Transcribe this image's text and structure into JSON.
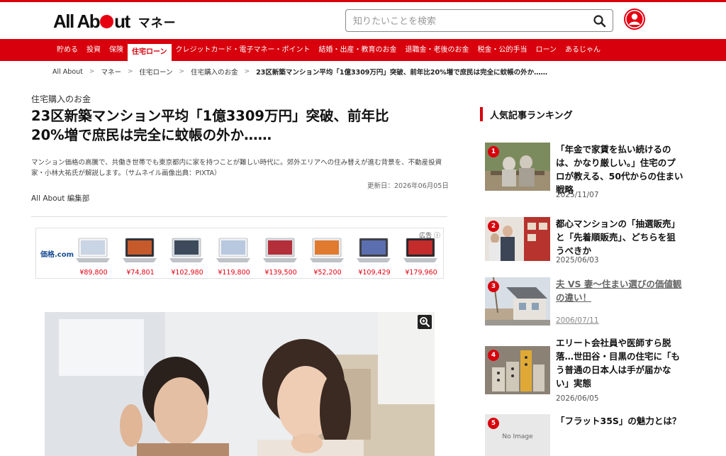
{
  "header": {
    "logo_text_1": "All Ab",
    "logo_text_2": "ut",
    "category": "マネー",
    "search_placeholder": "知りたいことを検索"
  },
  "nav": {
    "items": [
      {
        "label": "貯める"
      },
      {
        "label": "投資"
      },
      {
        "label": "保険"
      },
      {
        "label": "住宅ローン",
        "active": true
      },
      {
        "label": "クレジットカード・電子マネー・ポイント"
      },
      {
        "label": "結婚・出産・教育のお金"
      },
      {
        "label": "退職金・老後のお金"
      },
      {
        "label": "税金・公的手当"
      },
      {
        "label": "ローン"
      },
      {
        "label": "あるじゃん"
      }
    ]
  },
  "breadcrumb": {
    "items": [
      "All About",
      "マネー",
      "住宅ローン",
      "住宅購入のお金"
    ],
    "current": "23区新築マンション平均「1億3309万円」突破、前年比20%増で庶民は完全に蚊帳の外か……"
  },
  "article": {
    "category": "住宅購入のお金",
    "title_line1": "23区新築マンション平均「1億3309万円」突破、前年比",
    "title_line2": "20%増で庶民は完全に蚊帳の外か……",
    "description": "マンション価格の高騰で、共働き世帯でも東京都内に家を持つことが難しい時代に。郊外エリアへの住み替えが進む背景を、不動産投資家・小林大祐氏が解説します。（サムネイル画像出典：PIXTA）",
    "updated": "更新日：2026年06月05日",
    "author": "All About 編集部"
  },
  "ad": {
    "logo": "価格.com",
    "label": "広告 ⓘ",
    "prices": [
      "¥89,800",
      "¥74,801",
      "¥102,980",
      "¥119,800",
      "¥139,500",
      "¥52,200",
      "¥109,429",
      "¥179,960"
    ]
  },
  "sidebar": {
    "title": "人気記事ランキング",
    "items": [
      {
        "rank": "1",
        "title": "「年金で家賃を払い続けるのは、かなり厳しい。」住宅のプロが教える、50代からの住まい戦略",
        "date": "2025/11/07"
      },
      {
        "rank": "2",
        "title": "都心マンションの「抽選販売」と「先着順販売」、どちらを狙うべきか",
        "date": "2025/06/03"
      },
      {
        "rank": "3",
        "title": "夫 VS 妻～住まい選びの価値観の違い！",
        "date": "2006/07/11"
      },
      {
        "rank": "4",
        "title": "エリート会社員や医師すら脱落…世田谷・目黒の住宅に「もう普通の日本人は手が届かない」実態",
        "date": "2026/06/05"
      },
      {
        "rank": "5",
        "title": "「フラット35S」の魅力とは？",
        "no_image": "No Image"
      }
    ]
  },
  "colors": {
    "brand_red": "#d8000c",
    "price_red": "#e60012"
  }
}
